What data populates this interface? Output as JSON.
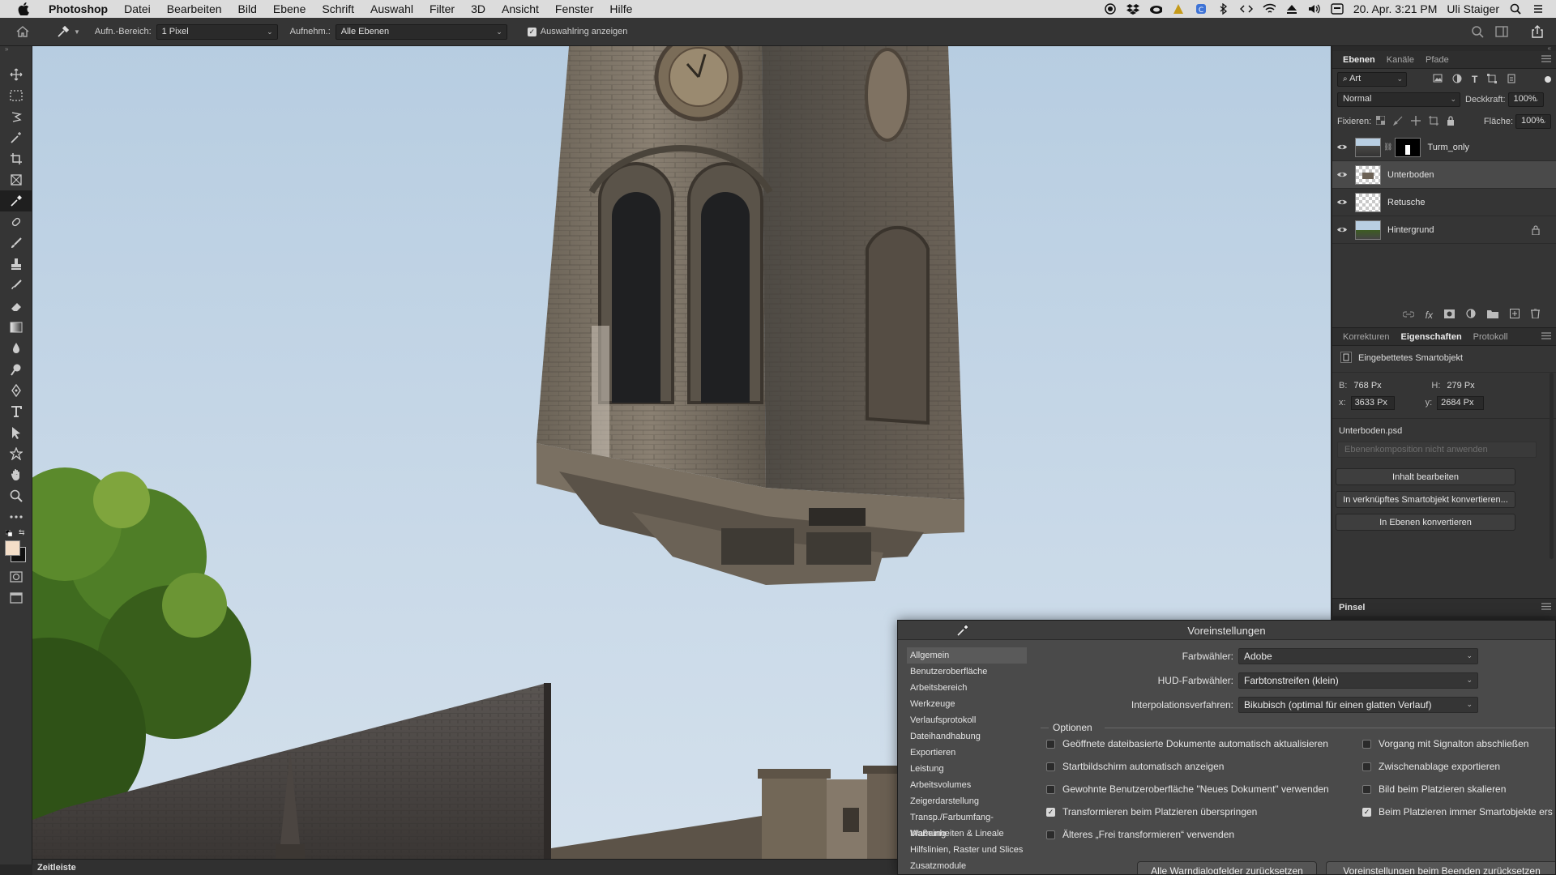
{
  "menubar": {
    "app": "Photoshop",
    "items": [
      "Datei",
      "Bearbeiten",
      "Bild",
      "Ebene",
      "Schrift",
      "Auswahl",
      "Filter",
      "3D",
      "Ansicht",
      "Fenster",
      "Hilfe"
    ],
    "datetime": "20. Apr. 3:21 PM",
    "user": "Uli Staiger"
  },
  "optionsbar": {
    "sample_size_label": "Aufn.-Bereich:",
    "sample_size_value": "1 Pixel",
    "sample_label": "Aufnehm.:",
    "sample_value": "Alle Ebenen",
    "show_ring_label": "Auswahlring anzeigen"
  },
  "layers_panel": {
    "tabs": [
      "Ebenen",
      "Kanäle",
      "Pfade"
    ],
    "filter_value": "Art",
    "blend_mode": "Normal",
    "opacity_label": "Deckkraft:",
    "opacity_value": "100%",
    "lock_label": "Fixieren:",
    "fill_label": "Fläche:",
    "fill_value": "100%",
    "layers": [
      {
        "name": "Turm_only"
      },
      {
        "name": "Unterboden"
      },
      {
        "name": "Retusche"
      },
      {
        "name": "Hintergrund"
      }
    ]
  },
  "properties_panel": {
    "tabs": [
      "Korrekturen",
      "Eigenschaften",
      "Protokoll"
    ],
    "type_label": "Eingebettetes Smartobjekt",
    "w_label": "B:",
    "w_value": "768 Px",
    "h_label": "H:",
    "h_value": "279 Px",
    "x_label": "x:",
    "x_value": "3633 Px",
    "y_label": "y:",
    "y_value": "2684 Px",
    "filename": "Unterboden.psd",
    "comp_placeholder": "Ebenenkomposition nicht anwenden",
    "buttons": [
      "Inhalt bearbeiten",
      "In verknüpftes Smartobjekt konvertieren...",
      "In Ebenen konvertieren"
    ]
  },
  "brush_panel": {
    "title": "Pinsel"
  },
  "timeline": {
    "label": "Zeitleiste"
  },
  "preferences": {
    "title": "Voreinstellungen",
    "nav": [
      "Allgemein",
      "Benutzeroberfläche",
      "Arbeitsbereich",
      "Werkzeuge",
      "Verlaufsprotokoll",
      "Dateihandhabung",
      "Exportieren",
      "Leistung",
      "Arbeitsvolumes",
      "Zeigerdarstellung",
      "Transp./Farbumfang-Warnung",
      "Maßeinheiten & Lineale",
      "Hilfslinien, Raster und Slices",
      "Zusatzmodule"
    ],
    "color_picker_label": "Farbwähler:",
    "color_picker_value": "Adobe",
    "hud_label": "HUD-Farbwähler:",
    "hud_value": "Farbtonstreifen (klein)",
    "interp_label": "Interpolationsverfahren:",
    "interp_value": "Bikubisch (optimal für einen glatten Verlauf)",
    "options_heading": "Optionen",
    "options_left": [
      {
        "label": "Geöffnete dateibasierte Dokumente automatisch aktualisieren",
        "checked": false
      },
      {
        "label": "Startbildschirm automatisch anzeigen",
        "checked": false
      },
      {
        "label": "Gewohnte Benutzeroberfläche \"Neues Dokument\" verwenden",
        "checked": false
      },
      {
        "label": "Transformieren beim Platzieren überspringen",
        "checked": true
      },
      {
        "label": "Älteres „Frei transformieren“ verwenden",
        "checked": false
      }
    ],
    "options_right": [
      {
        "label": "Vorgang mit Signalton abschließen",
        "checked": false
      },
      {
        "label": "Zwischenablage exportieren",
        "checked": false
      },
      {
        "label": "Bild beim Platzieren skalieren",
        "checked": false
      },
      {
        "label": "Beim Platzieren immer Smartobjekte ers",
        "checked": true
      }
    ],
    "reset_warnings": "Alle Warndialogfelder zurücksetzen",
    "reset_on_quit": "Voreinstellungen beim Beenden zurücksetzen"
  }
}
